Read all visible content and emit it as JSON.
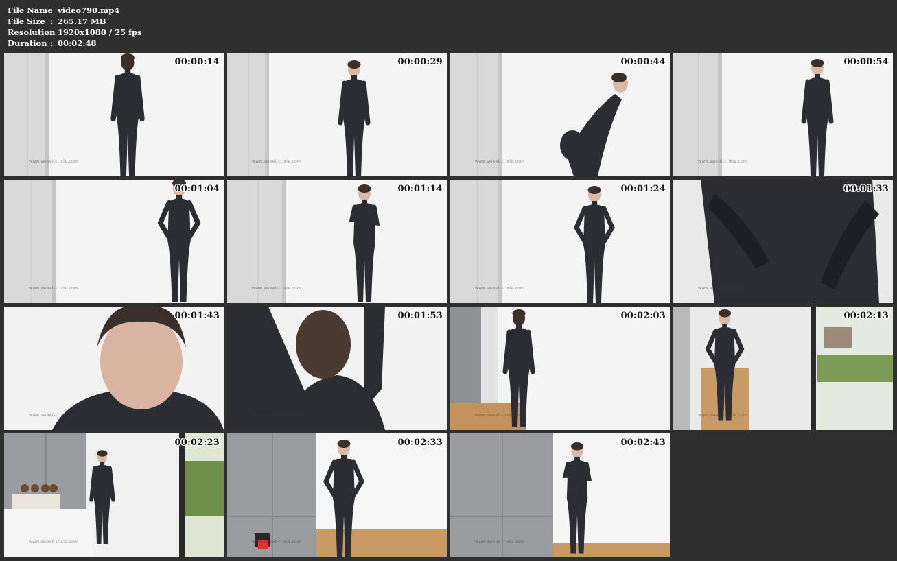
{
  "file_info": {
    "name_label": "File Name",
    "name_value": "video790.mp4",
    "size_label": "File Size",
    "size_value": "265.17 MB",
    "resolution_label": "Resolution",
    "resolution_value": "1920x1080 / 25 fps",
    "duration_label": "Duration",
    "duration_value": "00:02:48",
    "separator": ":"
  },
  "thumbnails": [
    {
      "timestamp": "00:00:14",
      "watermark": "www.sweet-trixie.com",
      "scene": "back-standing"
    },
    {
      "timestamp": "00:00:29",
      "watermark": "www.sweet-trixie.com",
      "scene": "front-standing"
    },
    {
      "timestamp": "00:00:44",
      "watermark": "www.sweet-trixie.com",
      "scene": "bending-side"
    },
    {
      "timestamp": "00:00:54",
      "watermark": "www.sweet-trixie.com",
      "scene": "side-standing"
    },
    {
      "timestamp": "00:01:04",
      "watermark": "www.sweet-trixie.com",
      "scene": "side-hand-hip"
    },
    {
      "timestamp": "00:01:14",
      "watermark": "www.sweet-trixie.com",
      "scene": "arms-crossed"
    },
    {
      "timestamp": "00:01:24",
      "watermark": "www.sweet-trixie.com",
      "scene": "hands-on-hips"
    },
    {
      "timestamp": "00:01:33",
      "watermark": "www.sweet-trixie.com",
      "scene": "closeup-hands"
    },
    {
      "timestamp": "00:01:43",
      "watermark": "www.sweet-trixie.com",
      "scene": "closeup-face"
    },
    {
      "timestamp": "00:01:53",
      "watermark": "www.sweet-trixie.com",
      "scene": "arms-up-back"
    },
    {
      "timestamp": "00:02:03",
      "watermark": "www.sweet-trixie.com",
      "scene": "room-back"
    },
    {
      "timestamp": "00:02:13",
      "watermark": "www.sweet-trixie.com",
      "scene": "window-heels"
    },
    {
      "timestamp": "00:02:23",
      "watermark": "www.sweet-trixie.com",
      "scene": "room-wide"
    },
    {
      "timestamp": "00:02:33",
      "watermark": "www.sweet-trixie.com",
      "scene": "cabinets-front"
    },
    {
      "timestamp": "00:02:43",
      "watermark": "www.sweet-trixie.com",
      "scene": "cabinets-side"
    }
  ],
  "colors": {
    "background": "#2f2f2f",
    "info_text": "#ffffff",
    "timestamp_text": "#111111",
    "latex_suit": "#2b2d33",
    "wall": "#f4f4f4",
    "cabinet": "#9a9c9f"
  }
}
